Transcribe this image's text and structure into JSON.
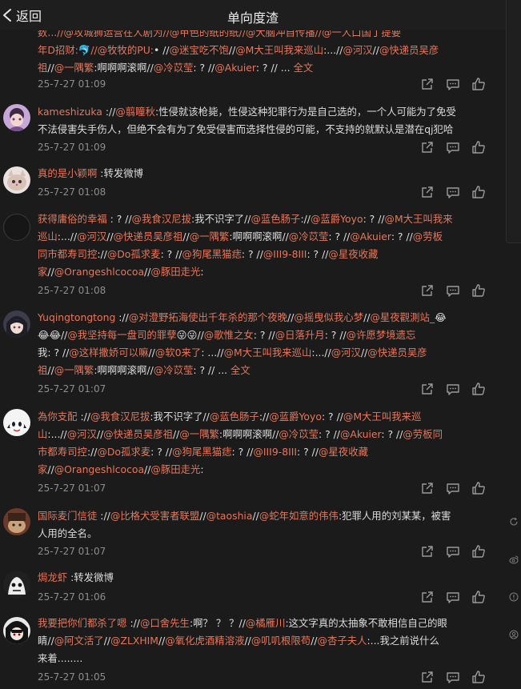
{
  "header": {
    "back_label": "返回",
    "title": "单向度渣"
  },
  "icons": {
    "back": "chevron-left-icon",
    "share": "share-icon",
    "comment": "comment-icon",
    "like": "thumbs-up-icon"
  },
  "colors": {
    "mention": "#e8765a",
    "background": "#1b1b1b",
    "meta": "#8d8d8d"
  },
  "comments": [
    {
      "username": "",
      "lines": [
        [
          {
            "t": "m",
            "v": "数...//@攻城狮运营在人剧为//@甲色的纸的纸//@大脑冲自传播//@一人口国丁提要"
          }
        ],
        [
          {
            "t": "m",
            "v": "年D招财:"
          },
          {
            "t": "p",
            "v": "🐬"
          },
          {
            "t": "m",
            "v": "//@牧牧的PU:"
          },
          {
            "t": "p",
            "v": "• //"
          },
          {
            "t": "m",
            "v": "@迷宝吃不饱"
          },
          {
            "t": "p",
            "v": "//"
          },
          {
            "t": "m",
            "v": "@M大王叫我来巡山"
          },
          {
            "t": "p",
            "v": ":...//"
          },
          {
            "t": "m",
            "v": "@河汉"
          },
          {
            "t": "p",
            "v": "//"
          },
          {
            "t": "m",
            "v": "@快递员吴彦"
          }
        ],
        [
          {
            "t": "m",
            "v": "祖"
          },
          {
            "t": "p",
            "v": "//"
          },
          {
            "t": "m",
            "v": "@一隅繁"
          },
          {
            "t": "p",
            "v": ":啊啊啊滚啊//"
          },
          {
            "t": "m",
            "v": "@冷苡莹"
          },
          {
            "t": "p",
            "v": ": ? //"
          },
          {
            "t": "m",
            "v": "@Akuier"
          },
          {
            "t": "p",
            "v": ": ? // ... "
          },
          {
            "t": "m",
            "v": "全文"
          }
        ]
      ],
      "time": "25-7-27 01:09"
    },
    {
      "username": "kameshizuka",
      "lines": [
        [
          {
            "t": "u",
            "v": "kameshizuka"
          },
          {
            "t": "p",
            "v": " ://"
          },
          {
            "t": "m",
            "v": "@翦瞳秋"
          },
          {
            "t": "p",
            "v": ":性侵就该枪毙，性侵这种犯罪行为是自己选的，一个人可能为了免受"
          }
        ],
        [
          {
            "t": "p",
            "v": "不法侵害失手伤人，但绝不会有为了免受侵害而选择性侵的可能，不支持的就默认是潜在qj犯哈"
          }
        ]
      ],
      "time": "25-7-27 01:09"
    },
    {
      "username": "真的是小颖啊",
      "lines": [
        [
          {
            "t": "u",
            "v": "真的是小颖啊"
          },
          {
            "t": "p",
            "v": " :转发微博"
          }
        ]
      ],
      "time": "25-7-27 01:08"
    },
    {
      "username": "获得庸俗的幸福",
      "lines": [
        [
          {
            "t": "u",
            "v": "获得庸俗的幸福"
          },
          {
            "t": "p",
            "v": " : ? //"
          },
          {
            "t": "m",
            "v": "@我食汉尼拔"
          },
          {
            "t": "p",
            "v": ":我不识字了//"
          },
          {
            "t": "m",
            "v": "@蓝色肠子"
          },
          {
            "t": "p",
            "v": "://"
          },
          {
            "t": "m",
            "v": "@蓝爵Yoyo"
          },
          {
            "t": "p",
            "v": ": ? //"
          },
          {
            "t": "m",
            "v": "@M大王叫我来"
          }
        ],
        [
          {
            "t": "m",
            "v": "巡山"
          },
          {
            "t": "p",
            "v": ":...//"
          },
          {
            "t": "m",
            "v": "@河汉"
          },
          {
            "t": "p",
            "v": "//"
          },
          {
            "t": "m",
            "v": "@快递员吴彦祖"
          },
          {
            "t": "p",
            "v": "//"
          },
          {
            "t": "m",
            "v": "@一隅繁"
          },
          {
            "t": "p",
            "v": ":啊啊啊滚啊//"
          },
          {
            "t": "m",
            "v": "@冷苡莹"
          },
          {
            "t": "p",
            "v": ": ? //"
          },
          {
            "t": "m",
            "v": "@Akuier"
          },
          {
            "t": "p",
            "v": ": ? //"
          },
          {
            "t": "m",
            "v": "@劳板"
          }
        ],
        [
          {
            "t": "m",
            "v": "同市都寿司控"
          },
          {
            "t": "p",
            "v": "://"
          },
          {
            "t": "m",
            "v": "@Do孤求麦"
          },
          {
            "t": "p",
            "v": ": ? //"
          },
          {
            "t": "m",
            "v": "@狗尾黑猫痣"
          },
          {
            "t": "p",
            "v": ": ? //"
          },
          {
            "t": "m",
            "v": "@III9-8III"
          },
          {
            "t": "p",
            "v": ": ? //"
          },
          {
            "t": "m",
            "v": "@星夜收藏"
          }
        ],
        [
          {
            "t": "m",
            "v": "家"
          },
          {
            "t": "p",
            "v": "//"
          },
          {
            "t": "m",
            "v": "@Orangeshlcocoa"
          },
          {
            "t": "p",
            "v": "//"
          },
          {
            "t": "m",
            "v": "@豚田走光"
          },
          {
            "t": "p",
            "v": ":"
          }
        ]
      ],
      "time": "25-7-27 01:08"
    },
    {
      "username": "Yuqingtongtong",
      "lines": [
        [
          {
            "t": "u",
            "v": "Yuqingtongtong"
          },
          {
            "t": "p",
            "v": " ://"
          },
          {
            "t": "m",
            "v": "@对澄野拓海使出千年杀的那个夜晚"
          },
          {
            "t": "p",
            "v": "//"
          },
          {
            "t": "m",
            "v": "@摇曳似我心梦"
          },
          {
            "t": "p",
            "v": "//"
          },
          {
            "t": "m",
            "v": "@星夜觀測站_"
          },
          {
            "t": "p",
            "v": "😂"
          }
        ],
        [
          {
            "t": "p",
            "v": "😂😂//"
          },
          {
            "t": "m",
            "v": "@我坚持每一盘司的罪孽"
          },
          {
            "t": "p",
            "v": "😜😜//"
          },
          {
            "t": "m",
            "v": "@歌惟之女"
          },
          {
            "t": "p",
            "v": ": ? //"
          },
          {
            "t": "m",
            "v": "@日落升月"
          },
          {
            "t": "p",
            "v": ": ? //"
          },
          {
            "t": "m",
            "v": "@许愿梦境遗忘"
          }
        ],
        [
          {
            "t": "p",
            "v": "我: ? //"
          },
          {
            "t": "m",
            "v": "@这样撒娇可以嘛"
          },
          {
            "t": "p",
            "v": "//"
          },
          {
            "t": "m",
            "v": "@软0来了"
          },
          {
            "t": "p",
            "v": ": ...//"
          },
          {
            "t": "m",
            "v": "@M大王叫我来巡山"
          },
          {
            "t": "p",
            "v": ":...//"
          },
          {
            "t": "m",
            "v": "@河汉"
          },
          {
            "t": "p",
            "v": "//"
          },
          {
            "t": "m",
            "v": "@快递员吴彦"
          }
        ],
        [
          {
            "t": "m",
            "v": "祖"
          },
          {
            "t": "p",
            "v": "//"
          },
          {
            "t": "m",
            "v": "@一隅繁"
          },
          {
            "t": "p",
            "v": ":啊啊啊滚啊//"
          },
          {
            "t": "m",
            "v": "@冷苡莹"
          },
          {
            "t": "p",
            "v": ": ? // ... "
          },
          {
            "t": "m",
            "v": "全文"
          }
        ]
      ],
      "time": "25-7-27 01:07"
    },
    {
      "username": "為你支配",
      "lines": [
        [
          {
            "t": "u",
            "v": "為你支配"
          },
          {
            "t": "p",
            "v": " ://"
          },
          {
            "t": "m",
            "v": "@我食汉尼拔"
          },
          {
            "t": "p",
            "v": ":我不识字了//"
          },
          {
            "t": "m",
            "v": "@蓝色肠子"
          },
          {
            "t": "p",
            "v": "://"
          },
          {
            "t": "m",
            "v": "@蓝爵Yoyo"
          },
          {
            "t": "p",
            "v": ": ? //"
          },
          {
            "t": "m",
            "v": "@M大王叫我来巡"
          }
        ],
        [
          {
            "t": "m",
            "v": "山"
          },
          {
            "t": "p",
            "v": ":...//"
          },
          {
            "t": "m",
            "v": "@河汉"
          },
          {
            "t": "p",
            "v": "//"
          },
          {
            "t": "m",
            "v": "@快递员吴彦祖"
          },
          {
            "t": "p",
            "v": "//"
          },
          {
            "t": "m",
            "v": "@一隅繁"
          },
          {
            "t": "p",
            "v": ":啊啊啊滚啊//"
          },
          {
            "t": "m",
            "v": "@冷苡莹"
          },
          {
            "t": "p",
            "v": ": ? //"
          },
          {
            "t": "m",
            "v": "@Akuier"
          },
          {
            "t": "p",
            "v": ": ? //"
          },
          {
            "t": "m",
            "v": "@劳板同"
          }
        ],
        [
          {
            "t": "m",
            "v": "市都寿司控"
          },
          {
            "t": "p",
            "v": "://"
          },
          {
            "t": "m",
            "v": "@Do孤求麦"
          },
          {
            "t": "p",
            "v": ": ? //"
          },
          {
            "t": "m",
            "v": "@狗尾黑猫痣"
          },
          {
            "t": "p",
            "v": ": ? //"
          },
          {
            "t": "m",
            "v": "@III9-8III"
          },
          {
            "t": "p",
            "v": ": ? //"
          },
          {
            "t": "m",
            "v": "@星夜收藏"
          }
        ],
        [
          {
            "t": "m",
            "v": "家"
          },
          {
            "t": "p",
            "v": "//"
          },
          {
            "t": "m",
            "v": "@Orangeshlcocoa"
          },
          {
            "t": "p",
            "v": "//"
          },
          {
            "t": "m",
            "v": "@豚田走光"
          },
          {
            "t": "p",
            "v": ":"
          }
        ]
      ],
      "time": "25-7-27 01:07"
    },
    {
      "username": "国际麦门信徒",
      "lines": [
        [
          {
            "t": "u",
            "v": "国际麦门信徒"
          },
          {
            "t": "p",
            "v": " ://"
          },
          {
            "t": "m",
            "v": "@比格犬受害者联盟"
          },
          {
            "t": "p",
            "v": "//"
          },
          {
            "t": "m",
            "v": "@taoshia"
          },
          {
            "t": "p",
            "v": "//"
          },
          {
            "t": "m",
            "v": "@蛇年如意的伟伟"
          },
          {
            "t": "p",
            "v": ":犯罪人用的刘某某，被害"
          }
        ],
        [
          {
            "t": "p",
            "v": "人用的全名。"
          }
        ]
      ],
      "time": "25-7-27 01:07"
    },
    {
      "username": "焗龙虾",
      "lines": [
        [
          {
            "t": "u",
            "v": "焗龙虾"
          },
          {
            "t": "p",
            "v": " :转发微博"
          }
        ]
      ],
      "time": "25-7-27 01:06"
    },
    {
      "username": "我要把你们都杀了嗯",
      "lines": [
        [
          {
            "t": "u",
            "v": "我要把你们都杀了嗯"
          },
          {
            "t": "p",
            "v": " ://"
          },
          {
            "t": "m",
            "v": "@口舍先生"
          },
          {
            "t": "p",
            "v": ":啊？ ？ ？//"
          },
          {
            "t": "m",
            "v": "@橘雁川"
          },
          {
            "t": "p",
            "v": ":这文字真的太抽象不敢相信自己的眼"
          }
        ],
        [
          {
            "t": "p",
            "v": "睛//"
          },
          {
            "t": "m",
            "v": "@阿文活了"
          },
          {
            "t": "p",
            "v": "//"
          },
          {
            "t": "m",
            "v": "@ZLXHIM"
          },
          {
            "t": "p",
            "v": "//"
          },
          {
            "t": "m",
            "v": "@氧化虎酒精溶液"
          },
          {
            "t": "p",
            "v": "//"
          },
          {
            "t": "m",
            "v": "@叽叽根限苟"
          },
          {
            "t": "p",
            "v": "//"
          },
          {
            "t": "m",
            "v": "@杏子夫人"
          },
          {
            "t": "p",
            "v": ":...我之前说什么"
          }
        ],
        [
          {
            "t": "p",
            "v": "来着........"
          }
        ]
      ],
      "time": "25-7-27 01:05"
    }
  ]
}
